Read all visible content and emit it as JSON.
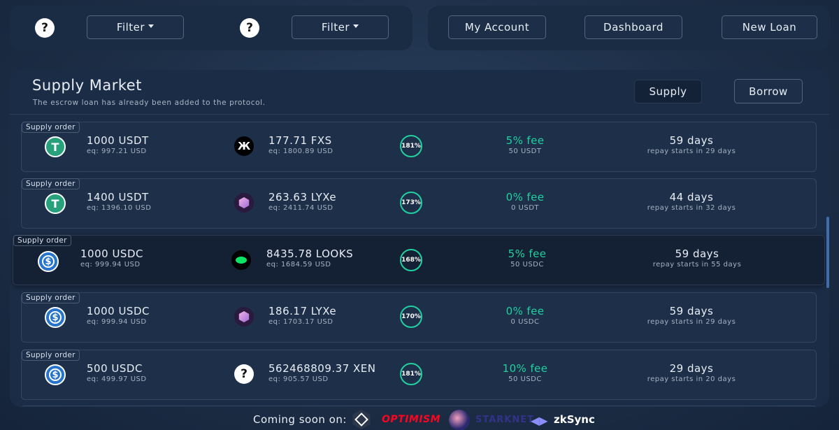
{
  "topbar": {
    "help_icon": "?",
    "filters": [
      {
        "label": "Filter"
      },
      {
        "label": "Filter"
      }
    ],
    "nav": {
      "my_account": "My Account",
      "dashboard": "Dashboard",
      "new_loan": "New Loan"
    }
  },
  "market": {
    "title": "Supply Market",
    "subtitle": "The escrow loan has already been added to the protocol.",
    "tabs": {
      "supply": "Supply",
      "borrow": "Borrow"
    }
  },
  "rows": [
    {
      "tag": "Supply order",
      "coin": "usdt-icon",
      "amount": "1000 USDT",
      "eq": "eq: 997.21 USD",
      "collateral_icon": "fxs-icon",
      "collateral": "177.71 FXS",
      "collateral_eq": "eq: 1800.89 USD",
      "ratio": "181%",
      "fee": "5% fee",
      "fee_sub": "50 USDT",
      "days": "59 days",
      "days_sub": "repay starts in 29 days"
    },
    {
      "tag": "Supply order",
      "coin": "usdt-icon",
      "amount": "1400 USDT",
      "eq": "eq: 1396.10 USD",
      "collateral_icon": "lyxe-icon",
      "collateral": "263.63 LYXe",
      "collateral_eq": "eq: 2411.74 USD",
      "ratio": "173%",
      "fee": "0% fee",
      "fee_sub": "0 USDT",
      "days": "44 days",
      "days_sub": "repay starts in 32 days"
    },
    {
      "tag": "Supply order",
      "coin": "usdc-icon",
      "amount": "1000 USDC",
      "eq": "eq: 999.94 USD",
      "collateral_icon": "looks-icon",
      "collateral": "8435.78 LOOKS",
      "collateral_eq": "eq: 1684.59 USD",
      "ratio": "168%",
      "fee": "5% fee",
      "fee_sub": "50 USDC",
      "days": "59 days",
      "days_sub": "repay starts in 55 days"
    },
    {
      "tag": "Supply order",
      "coin": "usdc-icon",
      "amount": "1000 USDC",
      "eq": "eq: 999.94 USD",
      "collateral_icon": "lyxe-icon",
      "collateral": "186.17 LYXe",
      "collateral_eq": "eq: 1703.17 USD",
      "ratio": "170%",
      "fee": "0% fee",
      "fee_sub": "0 USDC",
      "days": "59 days",
      "days_sub": "repay starts in 29 days"
    },
    {
      "tag": "Supply order",
      "coin": "usdc-icon",
      "amount": "500 USDC",
      "eq": "eq: 499.97 USD",
      "collateral_icon": "unknown-token-icon",
      "collateral": "562468809.37 XEN",
      "collateral_eq": "eq: 905.57 USD",
      "ratio": "181%",
      "fee": "10% fee",
      "fee_sub": "50 USDC",
      "days": "29 days",
      "days_sub": "repay starts in 20 days"
    }
  ],
  "footer": {
    "coming_soon": "Coming soon on:",
    "optimism": "OPTIMISM",
    "starknet": "STARKNET",
    "zksync": "zkSync"
  },
  "colors": {
    "accent_green": "#21d19f",
    "background": "#1c2d45",
    "panel": "#1b2c46"
  }
}
